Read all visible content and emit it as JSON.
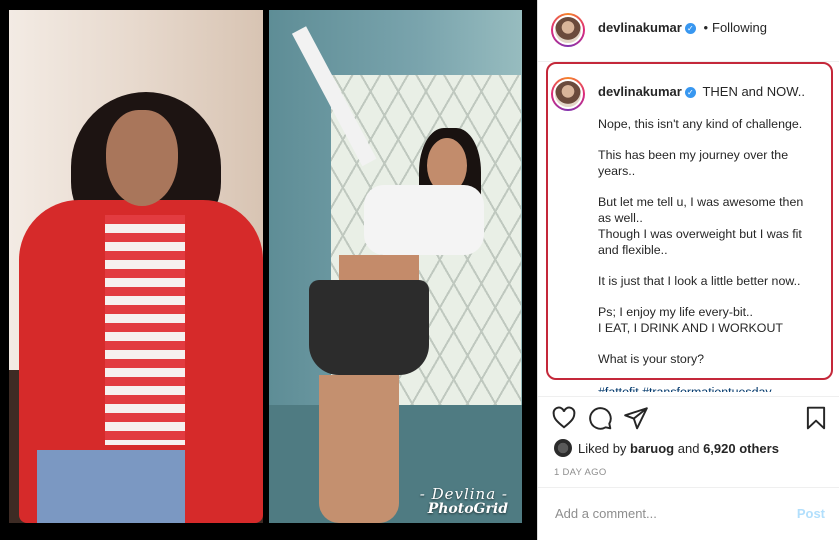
{
  "photo": {
    "watermark_name": "- Devlina -",
    "watermark_app": "PhotoGrid"
  },
  "header": {
    "username": "devlinakumar",
    "separator": "•",
    "follow_status": "Following"
  },
  "caption": {
    "username": "devlinakumar",
    "title": "THEN and NOW..",
    "paragraphs": [
      "Nope, this isn't any kind of challenge.",
      "This has been my journey over the years..",
      "But let me tell u, I was awesome then as well..\nThough I was overweight but I was fit and flexible..",
      "It is just that I look a little better now..",
      "Ps; I enjoy my life every-bit..\nI EAT, I DRINK AND I WORKOUT",
      "What is your story?"
    ],
    "hashtags": "#fattofit #transformationtuesday"
  },
  "likes": {
    "prefix": "Liked by",
    "user": "baruog",
    "conjunction": "and",
    "others": "6,920 others"
  },
  "timestamp": "1 DAY AGO",
  "comment": {
    "placeholder": "Add a comment...",
    "post_label": "Post"
  },
  "icons": [
    "heart-icon",
    "comment-icon",
    "share-icon",
    "bookmark-icon",
    "verified-badge-icon"
  ],
  "colors": {
    "highlight_border": "#c4283a",
    "link_blue": "#00376b",
    "verified_blue": "#3897f0",
    "post_button_disabled": "#b2dffc"
  }
}
